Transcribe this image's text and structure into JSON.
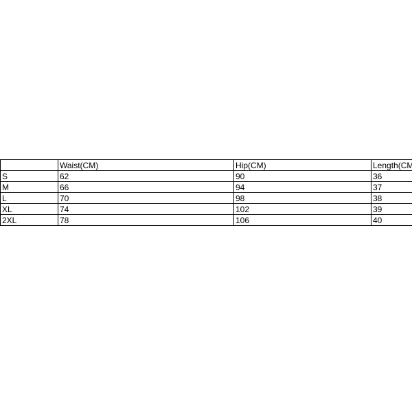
{
  "chart_data": {
    "type": "table",
    "title": "",
    "columns": [
      "",
      "Waist(CM)",
      "Hip(CM)",
      "Length(CM)"
    ],
    "rows": [
      [
        "S",
        "62",
        "90",
        "36"
      ],
      [
        "M",
        "66",
        "94",
        "37"
      ],
      [
        "L",
        "70",
        "98",
        "38"
      ],
      [
        "XL",
        "74",
        "102",
        "39"
      ],
      [
        "2XL",
        "78",
        "106",
        "40"
      ]
    ]
  }
}
